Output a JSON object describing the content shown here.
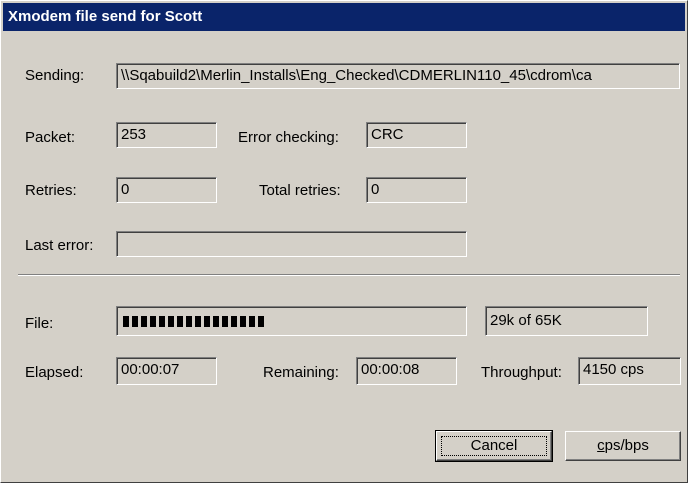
{
  "window": {
    "title": "Xmodem file send for Scott"
  },
  "sending": {
    "label": "Sending:",
    "value": "\\\\Sqabuild2\\Merlin_Installs\\Eng_Checked\\CDMERLIN110_45\\cdrom\\ca"
  },
  "packet": {
    "label": "Packet:",
    "value": "253"
  },
  "error_checking": {
    "label": "Error checking:",
    "value": "CRC"
  },
  "retries": {
    "label": "Retries:",
    "value": "0"
  },
  "total_retries": {
    "label": "Total retries:",
    "value": "0"
  },
  "last_error": {
    "label": "Last error:",
    "value": ""
  },
  "file": {
    "label": "File:",
    "progress_fraction": 0.45,
    "size_text": "29k of 65K"
  },
  "elapsed": {
    "label": "Elapsed:",
    "value": "00:00:07"
  },
  "remaining": {
    "label": "Remaining:",
    "value": "00:00:08"
  },
  "throughput": {
    "label": "Throughput:",
    "value": "4150 cps"
  },
  "buttons": {
    "cancel": "Cancel",
    "cps_bps_first": "c",
    "cps_bps_rest": "ps/bps"
  },
  "colors": {
    "titlebar": "#0a246a",
    "face": "#d4d0c8"
  }
}
